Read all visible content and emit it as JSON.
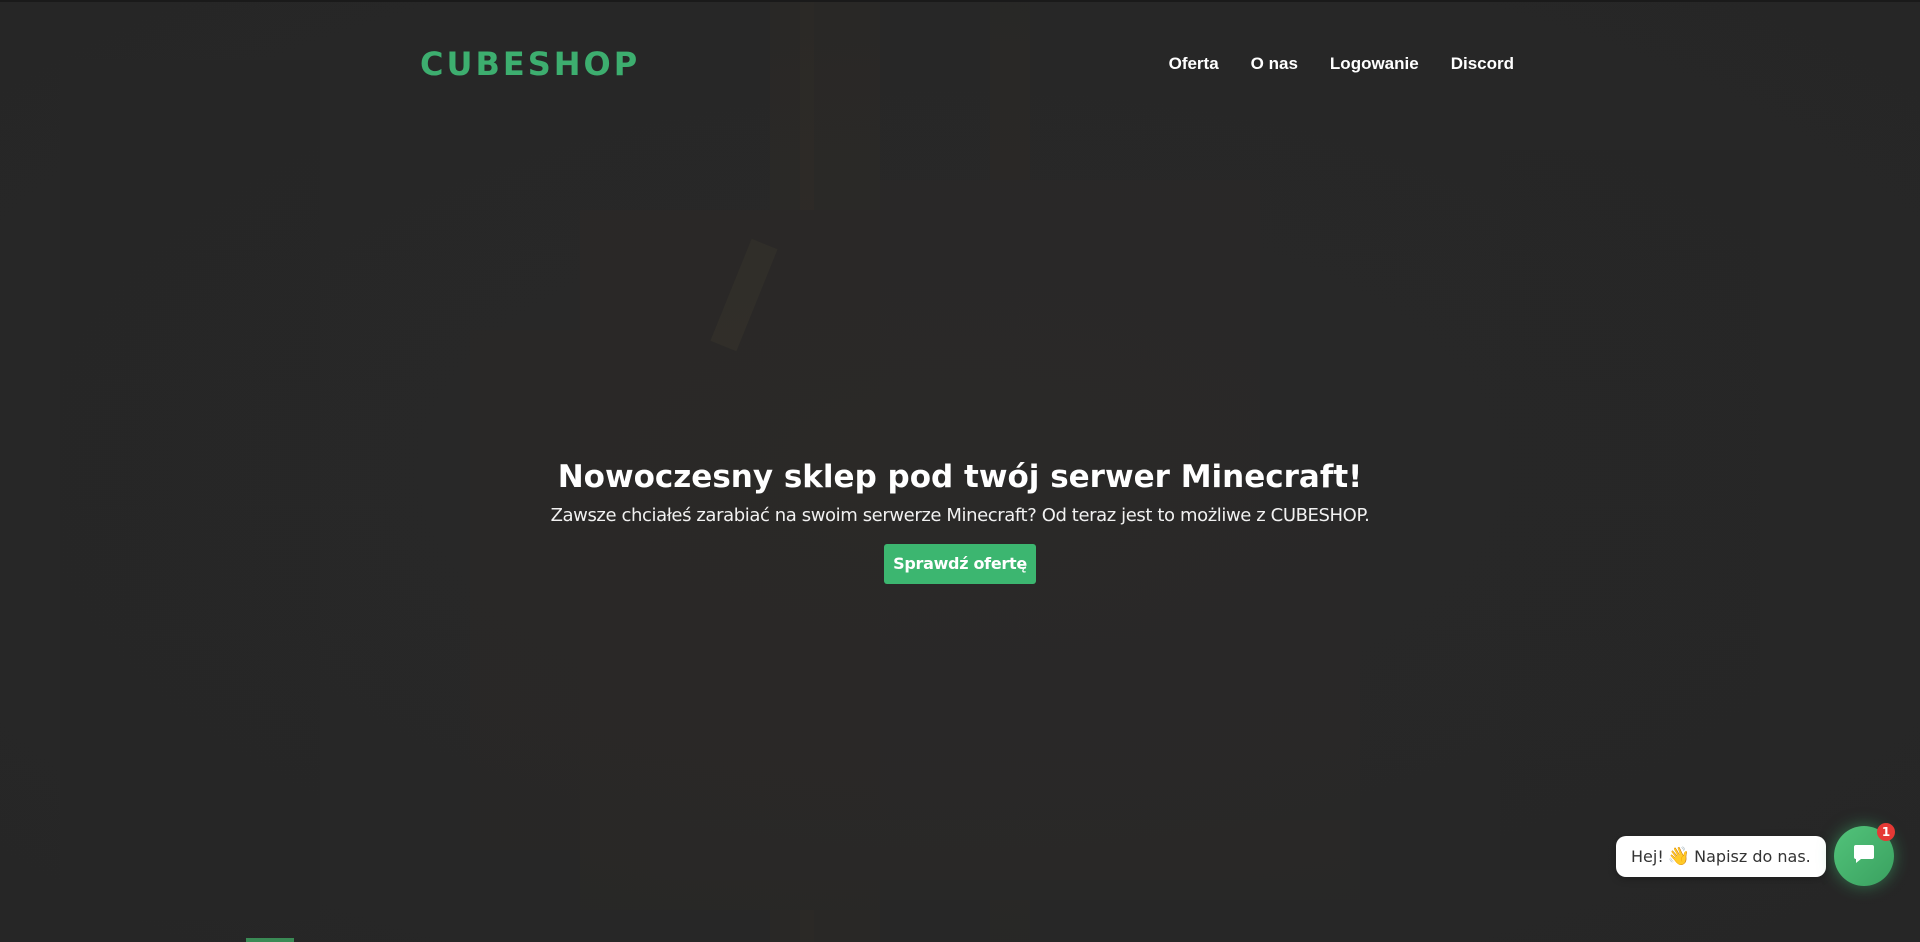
{
  "header": {
    "logo": "CUBESHOP",
    "nav": [
      "Oferta",
      "O nas",
      "Logowanie",
      "Discord"
    ]
  },
  "hero": {
    "title": "Nowoczesny sklep pod twój serwer Minecraft!",
    "subtitle": "Zawsze chciałeś zarabiać na swoim serwerze Minecraft? Od teraz jest to możliwe z CUBESHOP.",
    "cta_label": "Sprawdź ofertę"
  },
  "chat": {
    "greeting_prefix": "Hej!",
    "greeting_emoji": "👋",
    "greeting_suffix": "Napisz do nas.",
    "unread_count": "1",
    "icon": "chat-bubble-icon"
  },
  "colors": {
    "accent": "#3cb670",
    "logo": "#3dae6f",
    "background": "#282828",
    "badge": "#e53935"
  }
}
